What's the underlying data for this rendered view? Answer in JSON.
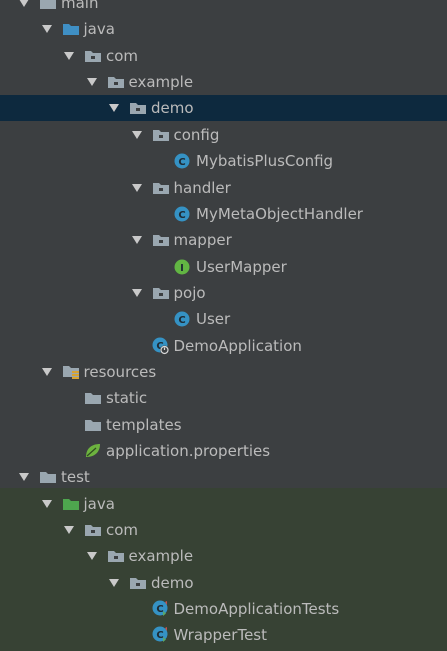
{
  "tree": {
    "nodes": [
      {
        "label": "main",
        "depth": 0,
        "expanded": true,
        "icon": "folder-gray-icon",
        "selected": false
      },
      {
        "label": "java",
        "depth": 1,
        "expanded": true,
        "icon": "folder-blue-icon",
        "selected": false
      },
      {
        "label": "com",
        "depth": 2,
        "expanded": true,
        "icon": "package-icon",
        "selected": false
      },
      {
        "label": "example",
        "depth": 3,
        "expanded": true,
        "icon": "package-icon",
        "selected": false
      },
      {
        "label": "demo",
        "depth": 4,
        "expanded": true,
        "icon": "package-icon",
        "selected": true
      },
      {
        "label": "config",
        "depth": 5,
        "expanded": true,
        "icon": "package-icon",
        "selected": false
      },
      {
        "label": "MybatisPlusConfig",
        "depth": 6,
        "expanded": null,
        "icon": "class-icon",
        "selected": false
      },
      {
        "label": "handler",
        "depth": 5,
        "expanded": true,
        "icon": "package-icon",
        "selected": false
      },
      {
        "label": "MyMetaObjectHandler",
        "depth": 6,
        "expanded": null,
        "icon": "class-icon",
        "selected": false
      },
      {
        "label": "mapper",
        "depth": 5,
        "expanded": true,
        "icon": "package-icon",
        "selected": false
      },
      {
        "label": "UserMapper",
        "depth": 6,
        "expanded": null,
        "icon": "interface-icon",
        "selected": false
      },
      {
        "label": "pojo",
        "depth": 5,
        "expanded": true,
        "icon": "package-icon",
        "selected": false
      },
      {
        "label": "User",
        "depth": 6,
        "expanded": null,
        "icon": "class-icon",
        "selected": false
      },
      {
        "label": "DemoApplication",
        "depth": 5,
        "expanded": null,
        "icon": "spring-class-icon",
        "selected": false
      },
      {
        "label": "resources",
        "depth": 1,
        "expanded": true,
        "icon": "resources-folder-icon",
        "selected": false
      },
      {
        "label": "static",
        "depth": 2,
        "expanded": null,
        "icon": "folder-gray-icon",
        "selected": false
      },
      {
        "label": "templates",
        "depth": 2,
        "expanded": null,
        "icon": "folder-gray-icon",
        "selected": false
      },
      {
        "label": "application.properties",
        "depth": 2,
        "expanded": null,
        "icon": "spring-leaf-icon",
        "selected": false
      },
      {
        "label": "test",
        "depth": 0,
        "expanded": true,
        "icon": "folder-gray-icon",
        "selected": false
      },
      {
        "label": "java",
        "depth": 1,
        "expanded": true,
        "icon": "folder-green-icon",
        "selected": false
      },
      {
        "label": "com",
        "depth": 2,
        "expanded": true,
        "icon": "package-icon",
        "selected": false
      },
      {
        "label": "example",
        "depth": 3,
        "expanded": true,
        "icon": "package-icon",
        "selected": false
      },
      {
        "label": "demo",
        "depth": 4,
        "expanded": true,
        "icon": "package-icon",
        "selected": false
      },
      {
        "label": "DemoApplicationTests",
        "depth": 5,
        "expanded": null,
        "icon": "test-class-icon",
        "selected": false
      },
      {
        "label": "WrapperTest",
        "depth": 5,
        "expanded": null,
        "icon": "test-class-icon",
        "selected": false
      }
    ]
  },
  "colors": {
    "background": "#3c3f41",
    "selection": "#0d293e",
    "test_background": "#374234",
    "text": "#bbbbbb",
    "folder_gray": "#9aa7b0",
    "folder_blue": "#3f8fc4",
    "folder_green": "#4ea64e",
    "class_badge": "#3592c4",
    "interface_badge": "#62b543",
    "spring_green": "#6db33f"
  }
}
